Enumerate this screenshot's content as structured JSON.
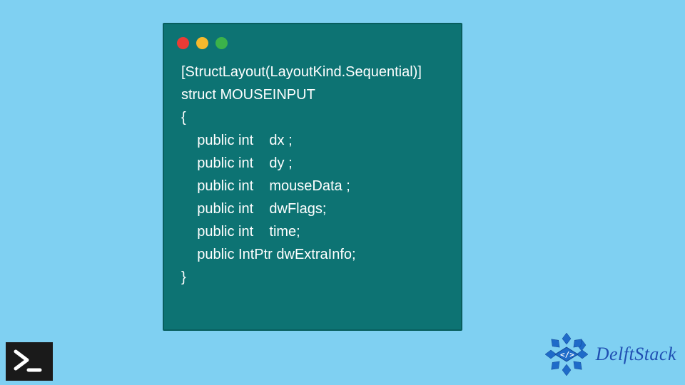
{
  "code": {
    "lines": [
      "[StructLayout(LayoutKind.Sequential)]",
      "struct MOUSEINPUT",
      "{",
      "    public int    dx ;",
      "    public int    dy ;",
      "    public int    mouseData ;",
      "    public int    dwFlags;",
      "    public int    time;",
      "    public IntPtr dwExtraInfo;",
      "}"
    ]
  },
  "brand": {
    "name": "DelftStack"
  }
}
